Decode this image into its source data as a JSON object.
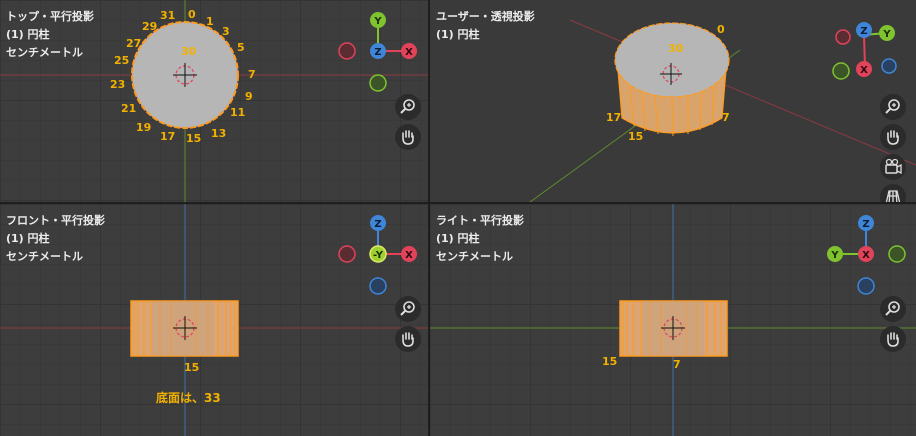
{
  "viewports": {
    "top": {
      "view": "トップ・平行投影",
      "object": "(1) 円柱",
      "units": "センチメートル"
    },
    "user": {
      "view": "ユーザー・透視投影",
      "object": "(1) 円柱"
    },
    "front": {
      "view": "フロント・平行投影",
      "object": "(1) 円柱",
      "units": "センチメートル"
    },
    "right": {
      "view": "ライト・平行投影",
      "object": "(1) 円柱",
      "units": "センチメートル"
    }
  },
  "vertex_labels": {
    "top": [
      "31",
      "0",
      "1",
      "29",
      "3",
      "27",
      "5",
      "25",
      "7",
      "23",
      "9",
      "21",
      "11",
      "19",
      "17",
      "15",
      "13",
      "30"
    ],
    "user": [
      "30",
      "0",
      "17",
      "15",
      "7"
    ],
    "front": [
      "15"
    ],
    "right": [
      "15",
      "7"
    ]
  },
  "gizmo_axes": {
    "x": "X",
    "y": "Y",
    "z": "Z",
    "neg_y": "-Y"
  },
  "note": "底面は、33",
  "colors": {
    "x_axis": "#e0435a",
    "y_axis": "#7fc32f",
    "z_axis": "#3f86d8",
    "vertex_number": "#f2b100",
    "mesh_face": "#b6b6b6",
    "selected_edge": "#ff9a1f"
  },
  "icons": [
    "zoom-icon",
    "hand-pan-icon",
    "camera-icon",
    "grid-view-icon"
  ]
}
